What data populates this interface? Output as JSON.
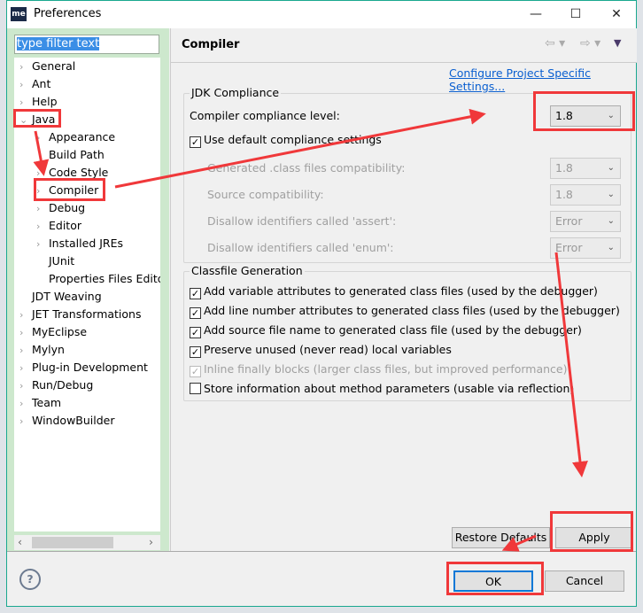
{
  "window": {
    "title": "Preferences",
    "logo": "me",
    "minimize_icon": "minimize-icon",
    "maximize_icon": "maximize-icon",
    "close_icon": "close-icon"
  },
  "filter": {
    "value": "type filter text"
  },
  "tree": [
    {
      "label": "General",
      "indent": 0,
      "chev": "›"
    },
    {
      "label": "Ant",
      "indent": 0,
      "chev": "›"
    },
    {
      "label": "Help",
      "indent": 0,
      "chev": "›"
    },
    {
      "label": "Java",
      "indent": 0,
      "chev": "⌄"
    },
    {
      "label": "Appearance",
      "indent": 1,
      "chev": "›"
    },
    {
      "label": "Build Path",
      "indent": 1,
      "chev": ""
    },
    {
      "label": "Code Style",
      "indent": 1,
      "chev": "›"
    },
    {
      "label": "Compiler",
      "indent": 1,
      "chev": "›"
    },
    {
      "label": "Debug",
      "indent": 1,
      "chev": "›"
    },
    {
      "label": "Editor",
      "indent": 1,
      "chev": "›"
    },
    {
      "label": "Installed JREs",
      "indent": 1,
      "chev": "›"
    },
    {
      "label": "JUnit",
      "indent": 1,
      "chev": ""
    },
    {
      "label": "Properties Files Editor",
      "indent": 1,
      "chev": ""
    },
    {
      "label": "JDT Weaving",
      "indent": 0,
      "chev": ""
    },
    {
      "label": "JET Transformations",
      "indent": 0,
      "chev": "›"
    },
    {
      "label": "MyEclipse",
      "indent": 0,
      "chev": "›"
    },
    {
      "label": "Mylyn",
      "indent": 0,
      "chev": "›"
    },
    {
      "label": "Plug-in Development",
      "indent": 0,
      "chev": "›"
    },
    {
      "label": "Run/Debug",
      "indent": 0,
      "chev": "›"
    },
    {
      "label": "Team",
      "indent": 0,
      "chev": "›"
    },
    {
      "label": "WindowBuilder",
      "indent": 0,
      "chev": "›"
    }
  ],
  "page": {
    "title": "Compiler",
    "configure_link": "Configure Project Specific Settings...",
    "jdk": {
      "legend": "JDK Compliance",
      "level_label": "Compiler compliance level:",
      "level_value": "1.8",
      "use_default": "Use default compliance settings",
      "rows": [
        {
          "label": "Generated .class files compatibility:",
          "value": "1.8"
        },
        {
          "label": "Source compatibility:",
          "value": "1.8"
        },
        {
          "label": "Disallow identifiers called 'assert':",
          "value": "Error"
        },
        {
          "label": "Disallow identifiers called 'enum':",
          "value": "Error"
        }
      ]
    },
    "classfile": {
      "legend": "Classfile Generation",
      "options": [
        {
          "label": "Add variable attributes to generated class files (used by the debugger)",
          "checked": true,
          "disabled": false
        },
        {
          "label": "Add line number attributes to generated class files (used by the debugger)",
          "checked": true,
          "disabled": false
        },
        {
          "label": "Add source file name to generated class file (used by the debugger)",
          "checked": true,
          "disabled": false
        },
        {
          "label": "Preserve unused (never read) local variables",
          "checked": true,
          "disabled": false
        },
        {
          "label": "Inline finally blocks (larger class files, but improved performance)",
          "checked": true,
          "disabled": true
        },
        {
          "label": "Store information about method parameters (usable via reflection)",
          "checked": false,
          "disabled": false
        }
      ]
    },
    "restore_defaults": "Restore Defaults",
    "apply": "Apply"
  },
  "footer": {
    "ok": "OK",
    "cancel": "Cancel",
    "help_icon": "help-icon"
  },
  "annotation_color": "#f0383a"
}
